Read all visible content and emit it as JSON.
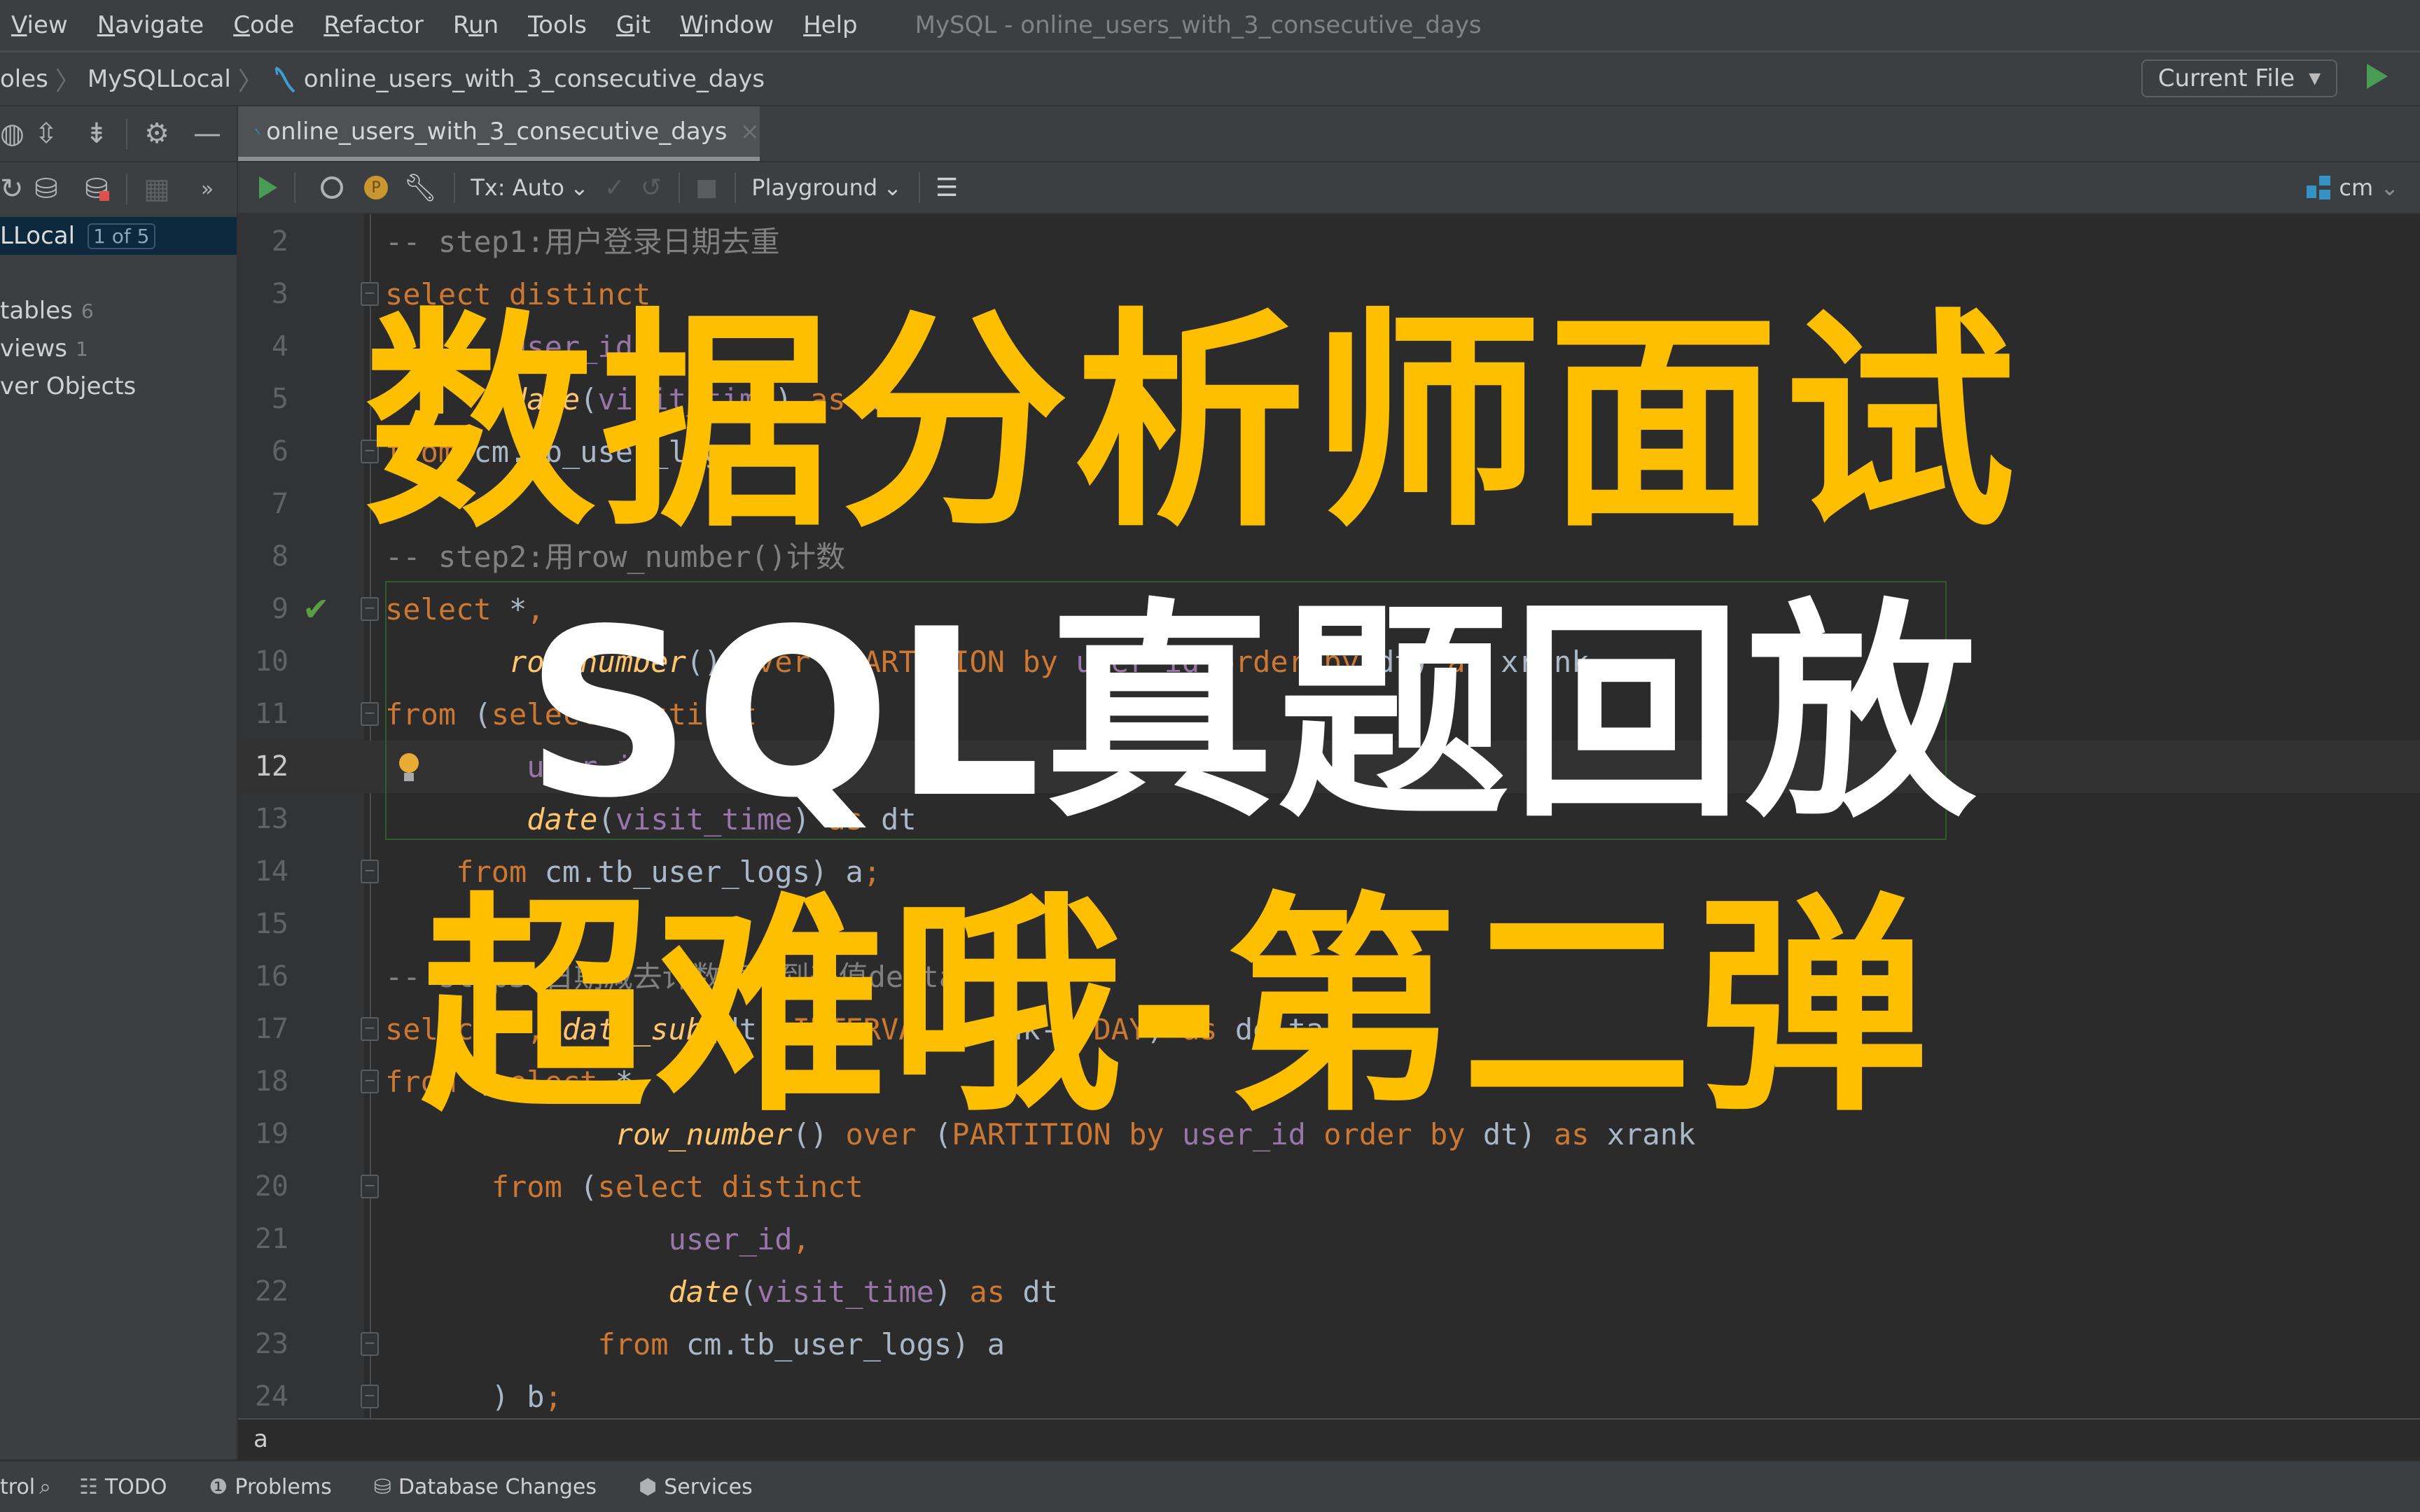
{
  "menubar": {
    "items": [
      {
        "label": "View",
        "mnemonic": "V"
      },
      {
        "label": "Navigate",
        "mnemonic": "N"
      },
      {
        "label": "Code",
        "mnemonic": "C"
      },
      {
        "label": "Refactor",
        "mnemonic": "R"
      },
      {
        "label": "Run",
        "mnemonic": "u"
      },
      {
        "label": "Tools",
        "mnemonic": "T"
      },
      {
        "label": "Git",
        "mnemonic": "G"
      },
      {
        "label": "Window",
        "mnemonic": "W"
      },
      {
        "label": "Help",
        "mnemonic": "H"
      }
    ],
    "window_title": "MySQL - online_users_with_3_consecutive_days"
  },
  "breadcrumb": {
    "items": [
      "oles",
      "MySQLLocal",
      "online_users_with_3_consecutive_days"
    ]
  },
  "run_config": {
    "label": "Current File",
    "caret": "▼"
  },
  "left_panel": {
    "selected": {
      "label": "LLocal",
      "badge": "1 of 5"
    },
    "tree": [
      {
        "label": "tables",
        "count": "6"
      },
      {
        "label": "views",
        "count": "1"
      },
      {
        "label": "ver Objects",
        "count": ""
      }
    ],
    "more": "»"
  },
  "tab": {
    "label": "online_users_with_3_consecutive_days",
    "close": "×"
  },
  "editor_toolbar": {
    "tx_mode": "Tx: Auto",
    "session": "Playground",
    "schema": "cm",
    "caret": "⌄",
    "p_badge": "P"
  },
  "editor": {
    "current_line": 12,
    "lines": [
      {
        "n": "2",
        "tokens": [
          {
            "t": "-- step1:用户登录日期去重",
            "c": "cm"
          }
        ]
      },
      {
        "n": "3",
        "tokens": [
          {
            "t": "select distinct",
            "c": "kw"
          }
        ]
      },
      {
        "n": "4",
        "tokens": [
          {
            "t": "       ",
            "c": ""
          },
          {
            "t": "user_id",
            "c": "col"
          },
          {
            "t": ",",
            "c": "kw"
          }
        ]
      },
      {
        "n": "5",
        "tokens": [
          {
            "t": "       ",
            "c": ""
          },
          {
            "t": "date",
            "c": "fn"
          },
          {
            "t": "(",
            "c": ""
          },
          {
            "t": "visit_time",
            "c": "col"
          },
          {
            "t": ") ",
            "c": ""
          },
          {
            "t": "as",
            "c": "kw"
          },
          {
            "t": " dt",
            "c": ""
          }
        ]
      },
      {
        "n": "6",
        "tokens": [
          {
            "t": "from",
            "c": "kw"
          },
          {
            "t": " cm.tb_user_logs",
            "c": ""
          }
        ]
      },
      {
        "n": "7",
        "tokens": []
      },
      {
        "n": "8",
        "tokens": [
          {
            "t": "-- step2:用row_number()计数",
            "c": "cm"
          }
        ]
      },
      {
        "n": "9",
        "tokens": [
          {
            "t": "select",
            "c": "kw"
          },
          {
            "t": " *",
            "c": ""
          },
          {
            "t": ",",
            "c": "kw"
          }
        ]
      },
      {
        "n": "10",
        "tokens": [
          {
            "t": "       ",
            "c": ""
          },
          {
            "t": "row_number",
            "c": "fn"
          },
          {
            "t": "() ",
            "c": ""
          },
          {
            "t": "over",
            "c": "kw"
          },
          {
            "t": " (",
            "c": ""
          },
          {
            "t": "PARTITION by",
            "c": "kw"
          },
          {
            "t": " ",
            "c": ""
          },
          {
            "t": "user_id",
            "c": "col"
          },
          {
            "t": " ",
            "c": ""
          },
          {
            "t": "order by",
            "c": "kw"
          },
          {
            "t": " dt) ",
            "c": ""
          },
          {
            "t": "as",
            "c": "kw"
          },
          {
            "t": " xrank",
            "c": ""
          }
        ]
      },
      {
        "n": "11",
        "tokens": [
          {
            "t": "from",
            "c": "kw"
          },
          {
            "t": " (",
            "c": ""
          },
          {
            "t": "select distinct",
            "c": "kw"
          }
        ]
      },
      {
        "n": "12",
        "tokens": [
          {
            "t": "        ",
            "c": ""
          },
          {
            "t": "user_id",
            "c": "col"
          },
          {
            "t": ",",
            "c": "kw"
          }
        ]
      },
      {
        "n": "13",
        "tokens": [
          {
            "t": "        ",
            "c": ""
          },
          {
            "t": "date",
            "c": "fn"
          },
          {
            "t": "(",
            "c": ""
          },
          {
            "t": "visit_time",
            "c": "col"
          },
          {
            "t": ") ",
            "c": ""
          },
          {
            "t": "as",
            "c": "kw"
          },
          {
            "t": " dt",
            "c": ""
          }
        ]
      },
      {
        "n": "14",
        "tokens": [
          {
            "t": "    ",
            "c": ""
          },
          {
            "t": "from",
            "c": "kw"
          },
          {
            "t": " cm.tb_user_logs) a",
            "c": ""
          },
          {
            "t": ";",
            "c": "kw"
          }
        ]
      },
      {
        "n": "15",
        "tokens": []
      },
      {
        "n": "16",
        "tokens": [
          {
            "t": "-- step3:日期减去计数值得到差值delta",
            "c": "cm"
          }
        ]
      },
      {
        "n": "17",
        "tokens": [
          {
            "t": "select",
            "c": "kw"
          },
          {
            "t": " *",
            "c": ""
          },
          {
            "t": ", ",
            "c": "kw"
          },
          {
            "t": "date_sub",
            "c": "fn"
          },
          {
            "t": "(dt, ",
            "c": ""
          },
          {
            "t": "INTERVAL",
            "c": "kw"
          },
          {
            "t": " xrank-",
            "c": ""
          },
          {
            "t": "1",
            "c": "num"
          },
          {
            "t": " ",
            "c": ""
          },
          {
            "t": "DAY",
            "c": "kw"
          },
          {
            "t": ") ",
            "c": ""
          },
          {
            "t": "as",
            "c": "kw"
          },
          {
            "t": " delta",
            "c": ""
          }
        ]
      },
      {
        "n": "18",
        "tokens": [
          {
            "t": "from",
            "c": "kw"
          },
          {
            "t": " (",
            "c": ""
          },
          {
            "t": "select",
            "c": "kw"
          },
          {
            "t": " *",
            "c": ""
          },
          {
            "t": ",",
            "c": "kw"
          }
        ]
      },
      {
        "n": "19",
        "tokens": [
          {
            "t": "             ",
            "c": ""
          },
          {
            "t": "row_number",
            "c": "fn"
          },
          {
            "t": "() ",
            "c": ""
          },
          {
            "t": "over",
            "c": "kw"
          },
          {
            "t": " (",
            "c": ""
          },
          {
            "t": "PARTITION by",
            "c": "kw"
          },
          {
            "t": " ",
            "c": ""
          },
          {
            "t": "user_id",
            "c": "col"
          },
          {
            "t": " ",
            "c": ""
          },
          {
            "t": "order by",
            "c": "kw"
          },
          {
            "t": " dt) ",
            "c": ""
          },
          {
            "t": "as",
            "c": "kw"
          },
          {
            "t": " xrank",
            "c": ""
          }
        ]
      },
      {
        "n": "20",
        "tokens": [
          {
            "t": "      ",
            "c": ""
          },
          {
            "t": "from",
            "c": "kw"
          },
          {
            "t": " (",
            "c": ""
          },
          {
            "t": "select distinct",
            "c": "kw"
          }
        ]
      },
      {
        "n": "21",
        "tokens": [
          {
            "t": "                ",
            "c": ""
          },
          {
            "t": "user_id",
            "c": "col"
          },
          {
            "t": ",",
            "c": "kw"
          }
        ]
      },
      {
        "n": "22",
        "tokens": [
          {
            "t": "                ",
            "c": ""
          },
          {
            "t": "date",
            "c": "fn"
          },
          {
            "t": "(",
            "c": ""
          },
          {
            "t": "visit_time",
            "c": "col"
          },
          {
            "t": ") ",
            "c": ""
          },
          {
            "t": "as",
            "c": "kw"
          },
          {
            "t": " dt",
            "c": ""
          }
        ]
      },
      {
        "n": "23",
        "tokens": [
          {
            "t": "            ",
            "c": ""
          },
          {
            "t": "from",
            "c": "kw"
          },
          {
            "t": " cm.tb_user_logs) a",
            "c": ""
          }
        ]
      },
      {
        "n": "24",
        "tokens": [
          {
            "t": "      ) b",
            "c": ""
          },
          {
            "t": ";",
            "c": "kw"
          }
        ]
      }
    ],
    "fold_lines": [
      "3",
      "6",
      "9",
      "11",
      "14",
      "17",
      "18",
      "20",
      "23",
      "24"
    ],
    "check_line": "9",
    "bulb_line": "12"
  },
  "overlay": {
    "line1": "数据分析师面试",
    "line2": "SQL真题回放",
    "line3": "超难哦-第二弹",
    "colors": {
      "yellow": "#fdbf00",
      "white": "#ffffff"
    }
  },
  "status_field": {
    "value": "a"
  },
  "bottom_toolbar": {
    "items": [
      {
        "label": "trol",
        "icon": "version-control-icon"
      },
      {
        "label": "TODO",
        "icon": "todo-icon"
      },
      {
        "label": "Problems",
        "icon": "problems-icon"
      },
      {
        "label": "Database Changes",
        "icon": "database-changes-icon"
      },
      {
        "label": "Services",
        "icon": "services-icon"
      }
    ]
  }
}
